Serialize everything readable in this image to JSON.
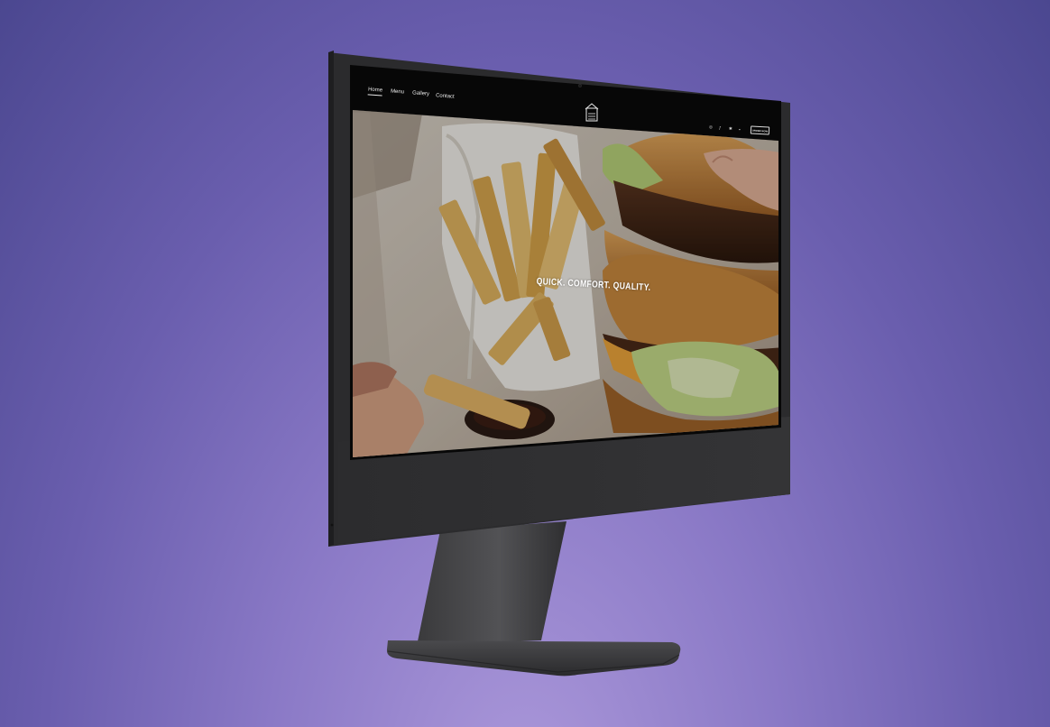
{
  "site": {
    "nav": [
      {
        "label": "Home",
        "active": true
      },
      {
        "label": "Menu",
        "active": false
      },
      {
        "label": "Gallery",
        "active": false
      },
      {
        "label": "Contact",
        "active": false
      }
    ],
    "order_button": "ORDER NOW",
    "hero_headline": "QUICK. COMFORT. QUALITY.",
    "social_icons": [
      "instagram-icon",
      "facebook-icon",
      "yelp-icon",
      "linkedin-icon"
    ],
    "logo_icon": "restaurant-logo-icon"
  },
  "colors": {
    "background_top": "#4b4790",
    "background_bottom": "#ab98da",
    "monitor_body": "#2a2a2c",
    "screen_nav": "#0a0808",
    "bun": "#c98a3e",
    "lettuce": "#b9d27a",
    "fries": "#e2b561"
  }
}
